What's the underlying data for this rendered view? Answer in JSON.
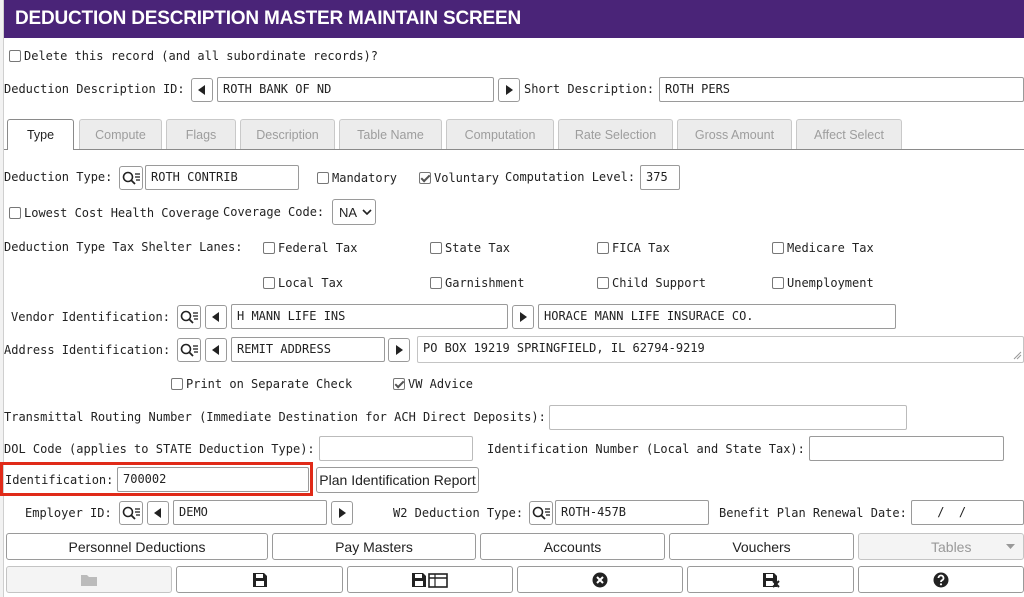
{
  "window": {
    "title": "DEDUCTION DESCRIPTION MASTER MAINTAIN SCREEN"
  },
  "delete_record": {
    "label": "Delete this record (and all subordinate records)?",
    "checked": false
  },
  "deduction_description": {
    "id_label": "Deduction Description ID:",
    "id_value": "ROTH BANK OF ND",
    "short_desc_label": "Short Description:",
    "short_desc_value": "ROTH PERS"
  },
  "tabs": [
    {
      "label": "Type",
      "active": true
    },
    {
      "label": "Compute",
      "active": false
    },
    {
      "label": "Flags",
      "active": false
    },
    {
      "label": "Description",
      "active": false
    },
    {
      "label": "Table Name",
      "active": false
    },
    {
      "label": "Computation",
      "active": false
    },
    {
      "label": "Rate Selection",
      "active": false
    },
    {
      "label": "Gross Amount",
      "active": false
    },
    {
      "label": "Affect Select",
      "active": false
    }
  ],
  "type_tab": {
    "deduction_type_label": "Deduction Type:",
    "deduction_type_value": "ROTH CONTRIB",
    "mandatory": {
      "label": "Mandatory",
      "checked": false
    },
    "voluntary": {
      "label": "Voluntary",
      "checked": true
    },
    "computation_level_label": "Computation Level:",
    "computation_level_value": "375",
    "lowest_cost": {
      "label": "Lowest Cost Health Coverage",
      "checked": false
    },
    "coverage_code_label": "Coverage Code:",
    "coverage_code_value": "NA",
    "tax_shelter_label": "Deduction Type Tax Shelter Lanes:",
    "tax_shelter": [
      {
        "label": "Federal Tax",
        "checked": false
      },
      {
        "label": "State Tax",
        "checked": false
      },
      {
        "label": "FICA Tax",
        "checked": false
      },
      {
        "label": "Medicare Tax",
        "checked": false
      },
      {
        "label": "Local Tax",
        "checked": false
      },
      {
        "label": "Garnishment",
        "checked": false
      },
      {
        "label": "Child Support",
        "checked": false
      },
      {
        "label": "Unemployment",
        "checked": false
      }
    ],
    "vendor_label": "Vendor Identification:",
    "vendor_id": "H MANN LIFE INS",
    "vendor_name": "HORACE MANN LIFE INSURACE CO.",
    "address_label": "Address Identification:",
    "address_id": "REMIT ADDRESS",
    "address_text": "PO BOX 19219 SPRINGFIELD, IL  62794-9219",
    "print_separate": {
      "label": "Print on Separate Check",
      "checked": false
    },
    "vw_advice": {
      "label": "VW Advice",
      "checked": true
    },
    "transmittal_label": "Transmittal Routing Number (Immediate Destination for ACH Direct Deposits):",
    "transmittal_value": "",
    "dol_label": "DOL Code (applies to STATE Deduction Type):",
    "dol_value": "",
    "ident_number_label": "Identification Number (Local and State Tax):",
    "ident_number_value": "",
    "identification_label": "Identification:",
    "identification_value": "700002",
    "plan_report_button": "Plan Identification Report",
    "employer_label": "Employer ID:",
    "employer_value": "DEMO",
    "w2_label": "W2 Deduction Type:",
    "w2_value": "ROTH-457B",
    "renewal_label": "Benefit Plan Renewal Date:",
    "renewal_value": " /  /"
  },
  "footer": {
    "nav_buttons": [
      "Personnel Deductions",
      "Pay Masters",
      "Accounts",
      "Vouchers"
    ],
    "tables_select": "Tables",
    "icons": [
      "folder-icon",
      "save-icon",
      "save-grid-icon",
      "cancel-icon",
      "save-exit-icon",
      "help-icon"
    ]
  },
  "colors": {
    "titlebar": "#4a2478",
    "highlight_box": "#e02a18"
  }
}
